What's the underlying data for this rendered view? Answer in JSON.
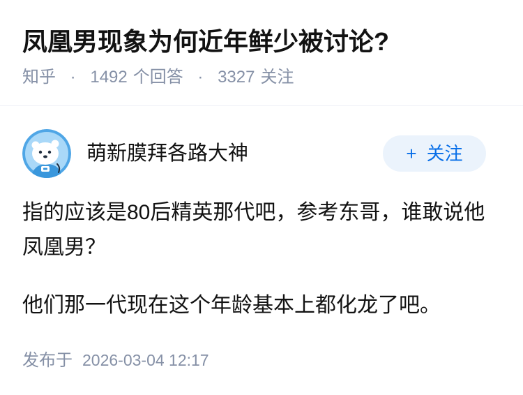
{
  "question": {
    "title": "凤凰男现象为何近年鲜少被讨论?",
    "source": "知乎",
    "separator": "·",
    "answer_count": "1492",
    "answer_label": "个回答",
    "follower_count": "3327",
    "follower_label": "关注"
  },
  "answer": {
    "author": {
      "name": "萌新膜拜各路大神",
      "avatar_icon": "cartoon-bear-icon"
    },
    "follow_button": {
      "prefix": "+",
      "label": "关注"
    },
    "paragraphs": [
      "指的应该是80后精英那代吧，参考东哥，谁敢说他凤凰男？",
      "他们那一代现在这个年龄基本上都化龙了吧。"
    ],
    "published_label": "发布于",
    "published_time": "2026-03-04 12:17"
  },
  "colors": {
    "text_primary": "#121212",
    "text_secondary": "#8590a6",
    "accent": "#056de8",
    "follow_button_bg": "#ebf3fc",
    "divider": "#f0f2f7"
  }
}
